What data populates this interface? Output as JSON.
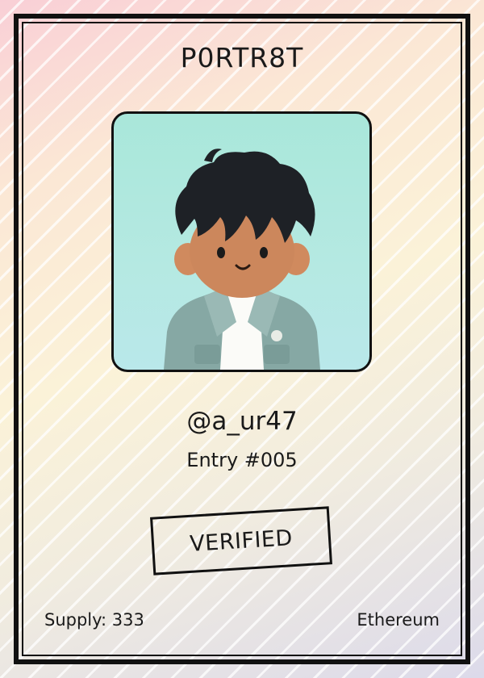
{
  "card": {
    "title": "P0RTR8T",
    "handle": "@a_ur47",
    "entry": "Entry #005",
    "stamp": "VERIFIED",
    "supply": "Supply: 333",
    "chain": "Ethereum"
  },
  "portrait": {
    "alt": "3D cartoon avatar of a boy with black hair, white shirt and teal jacket"
  },
  "colors": {
    "frame": "#111111",
    "portrait_bg": "#aee8df",
    "jacket": "#86a8a4",
    "hair": "#1e2126",
    "skin": "#c9845a"
  }
}
